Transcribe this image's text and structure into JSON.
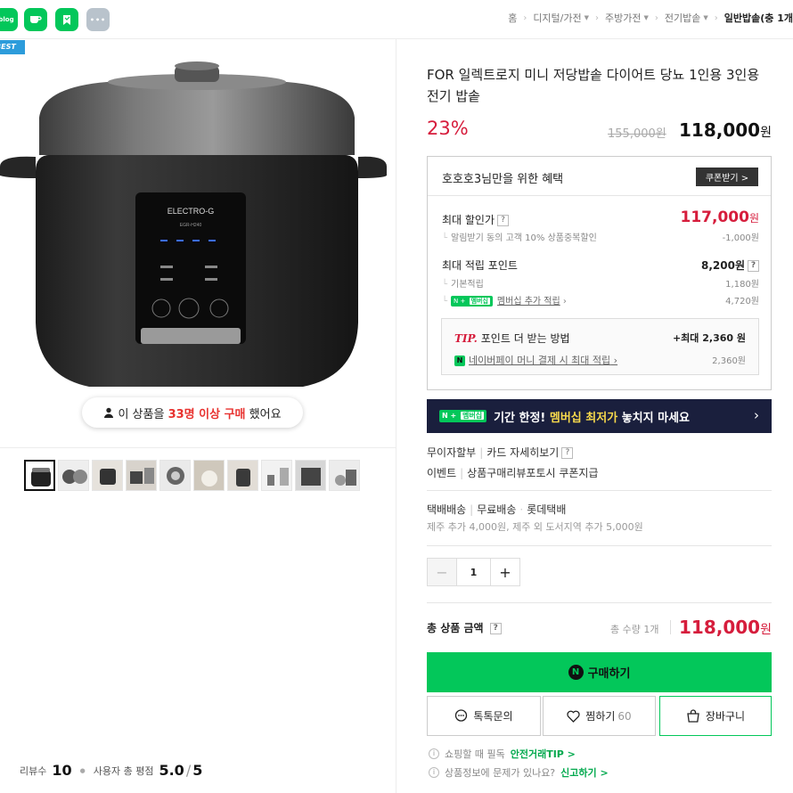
{
  "topbar": {
    "icons": [
      {
        "name": "blog-icon",
        "text": "blog",
        "color": "#03c75a"
      },
      {
        "name": "cafe-icon",
        "text": "☕",
        "color": "#03c75a"
      },
      {
        "name": "bookmark-icon",
        "text": "",
        "color": "#03c75a"
      },
      {
        "name": "more-icon",
        "text": "•••",
        "color": "#b9c3cc"
      }
    ],
    "breadcrumbs": [
      "홈",
      "디지털/가전",
      "주방가전",
      "전기밥솥",
      "일반밥솥(충 1개"
    ]
  },
  "gallery": {
    "best_badge": "BEST",
    "purchase_prefix": "이 상품을",
    "purchase_count": "33명 이상 구매",
    "purchase_suffix": "했어요",
    "product_brand_text": "ELECTRO-G",
    "product_model_text": "EGR-H240",
    "thumb_count": 10
  },
  "review": {
    "count_label": "리뷰수",
    "count": "10",
    "rating_label": "사용자 총 평점",
    "rating": "5.0",
    "rating_max": "5"
  },
  "product": {
    "title": "FOR 일렉트로지 미니 저당밥솥 다이어트 당뇨 1인용 3인용 전기 밥솥",
    "discount": "23%",
    "original_price": "155,000원",
    "price": "118,000",
    "won": "원"
  },
  "benefit": {
    "header": "호호호3님만을 위한 혜택",
    "coupon_button": "쿠폰받기 >",
    "max_discount_label": "최대 할인가",
    "max_discount_price": "117,000",
    "max_discount_won": "원",
    "discount_sub_label": "알림받기 동의 고객 10% 상품중복할인",
    "discount_sub_value": "-1,000원",
    "points_label": "최대 적립 포인트",
    "points_value": "8,200원",
    "basic_points_label": "기본적립",
    "basic_points_value": "1,180원",
    "membership_label": "멤버십 추가 적립",
    "membership_value": "4,720원",
    "tip_word": "TIP.",
    "tip_title": "포인트 더 받는 방법",
    "tip_max": "+최대 2,360 원",
    "tip_sub_label": "네이버페이 머니 결제 시 최대 적립",
    "tip_sub_value": "2,360원"
  },
  "banner": {
    "prefix": "기간 한정!",
    "highlight": "멤버십 최저가",
    "suffix": "놓치지 마세요"
  },
  "payment": {
    "installment": "무이자할부",
    "card_detail": "카드 자세히보기",
    "event_label": "이벤트",
    "event_text": "상품구매리뷰포토시 쿠폰지급"
  },
  "shipping": {
    "type": "택배배송",
    "free": "무료배송",
    "courier": "롯데택배",
    "note": "제주 추가 4,000원, 제주 외 도서지역 추가 5,000원"
  },
  "quantity": {
    "value": "1"
  },
  "total": {
    "label": "총 상품 금액",
    "qty_text": "총 수량 1개",
    "price": "118,000",
    "won": "원"
  },
  "actions": {
    "buy": "구매하기",
    "talk": "톡톡문의",
    "wish": "찜하기",
    "wish_count": "60",
    "cart": "장바구니"
  },
  "notes": {
    "safe_text": "쇼핑할 때 필독",
    "safe_link": "안전거래TIP >",
    "report_text": "상품정보에 문제가 있나요?",
    "report_link": "신고하기 >"
  },
  "colors": {
    "naver_green": "#03c75a",
    "sale_red": "#d61d3c",
    "banner_navy": "#1a1f3d"
  }
}
